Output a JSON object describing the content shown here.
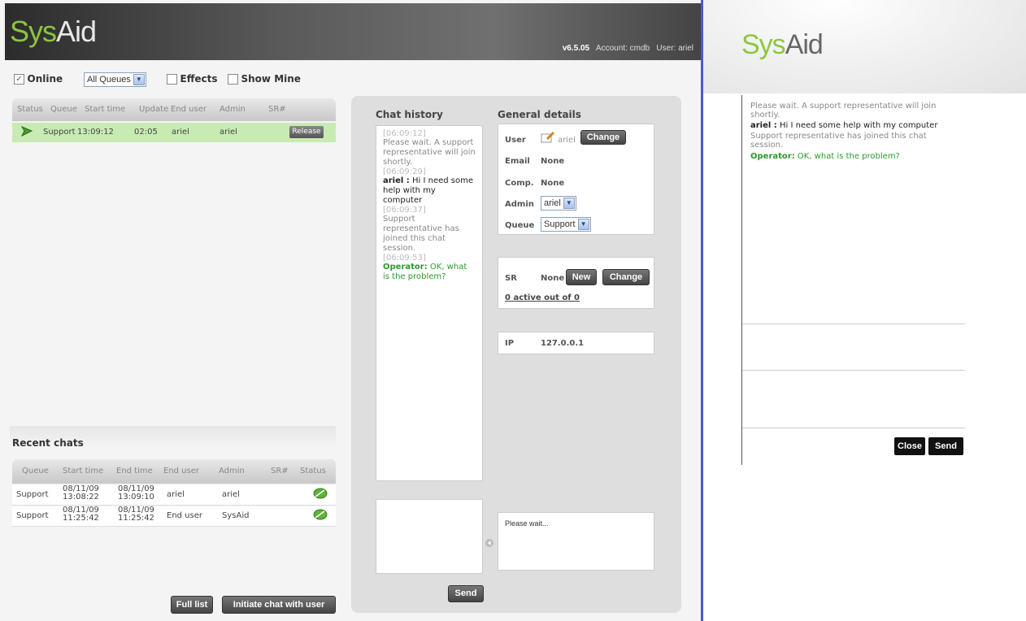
{
  "header": {
    "logo_sys": "Sys",
    "logo_aid": "Aid",
    "version": "v6.5.05",
    "account": "Account: cmdb",
    "user": "User: ariel"
  },
  "filters": {
    "online_label": "Online",
    "online_checked": true,
    "queue_select": "All Queues",
    "effects_label": "Effects",
    "show_mine_label": "Show Mine"
  },
  "active_table": {
    "headers": [
      "Status",
      "Queue",
      "Start time",
      "Update",
      "End user",
      "Admin",
      "SR#"
    ],
    "rows": [
      {
        "queue": "Support",
        "start_time": "13:09:12",
        "update": "02:05",
        "end_user": "ariel",
        "admin": "ariel",
        "action": "Release"
      }
    ]
  },
  "recent": {
    "title": "Recent chats",
    "headers": [
      "Queue",
      "Start time",
      "End time",
      "End user",
      "Admin",
      "SR#",
      "Status"
    ],
    "rows": [
      {
        "queue": "Support",
        "start_date": "08/11/09",
        "start_time": "13:08:22",
        "end_date": "08/11/09",
        "end_time": "13:09:10",
        "end_user": "ariel",
        "admin": "ariel"
      },
      {
        "queue": "Support",
        "start_date": "08/11/09",
        "start_time": "11:25:42",
        "end_date": "08/11/09",
        "end_time": "11:25:42",
        "end_user": "End user",
        "admin": "SysAid"
      }
    ]
  },
  "buttons": {
    "full_list": "Full list",
    "initiate_chat": "Initiate chat with user",
    "send": "Send",
    "change": "Change",
    "new": "New",
    "close": "Close"
  },
  "chat_history": {
    "title": "Chat history",
    "messages": [
      {
        "time": "[06:09:12]",
        "text": "Please wait. A support representative will join shortly."
      },
      {
        "time": "[06:09:29]",
        "sender": "ariel :",
        "text": "Hi I need some help with my computer"
      },
      {
        "time": "[06:09:37]",
        "text": "Support representative has joined this chat session."
      },
      {
        "time": "[06:09:53]",
        "sender": "Operator:",
        "text": "OK, what is the problem?"
      }
    ]
  },
  "general": {
    "title": "General details",
    "user_label": "User",
    "user_value": "ariel",
    "email_label": "Email",
    "email_value": "None",
    "comp_label": "Comp.",
    "comp_value": "None",
    "admin_label": "Admin",
    "admin_value": "ariel",
    "queue_label": "Queue",
    "queue_value": "Support",
    "sr_label": "SR",
    "sr_value": "None",
    "active_link": "0 active out of 0",
    "ip_label": "IP",
    "ip_value": "127.0.0.1"
  },
  "canned": {
    "text": "Please wait..."
  },
  "user_chat": {
    "msg1": "Please wait. A support representative will join shortly.",
    "msg2_sender": "ariel :",
    "msg2_text": "Hi I need some help with my computer",
    "msg3": "Support representative has joined this chat session.",
    "msg4_sender": "Operator:",
    "msg4_text": "OK, what is the problem?"
  },
  "colors": {
    "brand_green": "#8cc63f",
    "divider_blue": "#4b5cc4",
    "active_row": "#c8ebb4"
  }
}
